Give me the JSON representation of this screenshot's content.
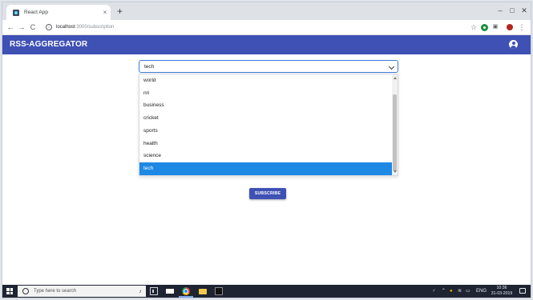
{
  "browser": {
    "tab_title": "React App",
    "tab_close": "×",
    "new_tab": "+",
    "window_controls": [
      "–",
      "□",
      "✕"
    ],
    "nav": {
      "back": "←",
      "forward": "→",
      "reload": "C"
    },
    "url_host": "localhost",
    "url_path": ":3000/subscription",
    "star": "☆",
    "ext_icon": "▣",
    "menu": "⋮"
  },
  "appbar": {
    "title": "RSS-AGGREGATOR",
    "color": "#3f51b5"
  },
  "category_select": {
    "value": "tech",
    "options": [
      "world",
      "nri",
      "business",
      "cricket",
      "sports",
      "health",
      "science",
      "tech"
    ],
    "selected": "tech",
    "highlight_color": "#1e88e5"
  },
  "subscribe_button": {
    "label": "SUBSCRIBE"
  },
  "taskbar": {
    "search_placeholder": "Type here to search",
    "tray_lang": "ENG",
    "time": "10:36",
    "date": "31-03-2019"
  }
}
